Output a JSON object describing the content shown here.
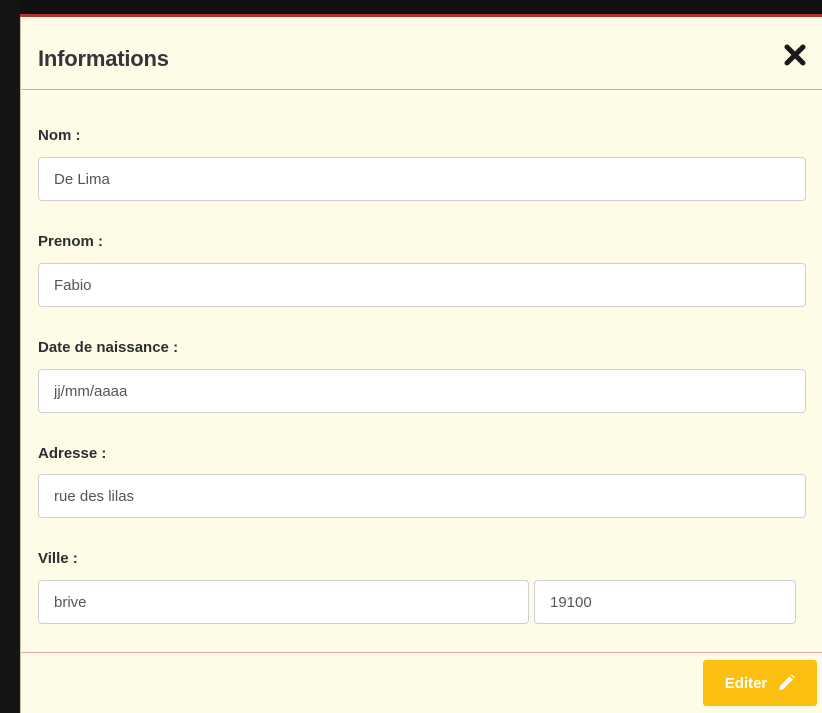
{
  "modal": {
    "title": "Informations",
    "close_icon": "close-icon"
  },
  "fields": {
    "nom": {
      "label": "Nom :",
      "value": "De Lima"
    },
    "prenom": {
      "label": "Prenom :",
      "value": "Fabio"
    },
    "date_naissance": {
      "label": "Date de naissance :",
      "value": "",
      "placeholder": "jj/mm/aaaa"
    },
    "adresse": {
      "label": "Adresse :",
      "value": "rue des lilas"
    },
    "ville": {
      "label": "Ville :",
      "city_value": "brive",
      "postal_code_value": "19100"
    }
  },
  "footer": {
    "edit_label": "Editer",
    "edit_icon": "pencil-icon"
  },
  "colors": {
    "modal_background": "#fefce6",
    "divider": "#e8a39c",
    "edit_button": "#fbbf11",
    "backdrop": "#111111",
    "backdrop_accent": "#b3342e"
  }
}
